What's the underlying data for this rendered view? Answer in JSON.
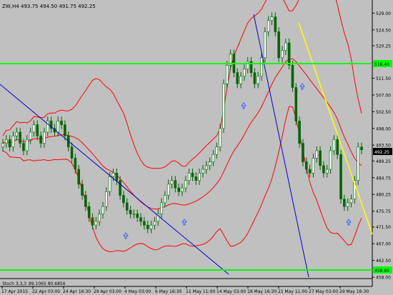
{
  "header": {
    "symbol": "ZW,H4",
    "ohlc": "493.75 494.50 491.75 492.25"
  },
  "sub_indicator": {
    "label": "Stoch 3,3,3",
    "values": "89.1065 80.6856"
  },
  "price_axis": {
    "ticks": [
      "529.00",
      "524.50",
      "520.25",
      "515.75",
      "511.50",
      "507.00",
      "502.50",
      "498.00",
      "493.50",
      "489.25",
      "484.75",
      "480.25",
      "475.75",
      "471.50",
      "467.00",
      "462.50",
      "458.00"
    ],
    "current_price": "492.25",
    "upper_line_label": "516.40",
    "lower_line_label": "458.85"
  },
  "time_axis": {
    "ticks": [
      "17 Apr 2015",
      "22 Apr 03:00",
      "24 Apr 16:30",
      "29 Apr 03:00",
      "4 May 03:00",
      "6 May 16:30",
      "11 May 11:00",
      "14 May 03:00",
      "18 May 16:30",
      "21 May 11:00",
      "27 May 03:00",
      "29 May 16:30"
    ]
  },
  "colors": {
    "background": "#c0c0c0",
    "candle": "#006400",
    "bollinger": "#ff0000",
    "hline": "#00ff00",
    "trendline": "#0000cc",
    "trendline_yellow": "#ffff00",
    "arrow": "#3366ff"
  },
  "chart_data": {
    "type": "line",
    "series": [
      {
        "values": [
          494,
          495,
          493,
          496,
          497,
          494,
          492,
          495,
          497,
          499,
          496,
          494,
          497,
          500,
          498,
          497,
          500,
          499,
          496,
          493,
          490,
          487,
          483,
          480,
          477,
          474,
          472,
          473,
          475,
          477,
          481,
          485,
          486,
          484,
          480,
          478,
          476,
          475,
          475,
          474,
          473,
          472,
          471,
          472,
          473,
          475,
          478,
          480,
          483,
          484,
          482,
          481,
          482,
          484,
          486,
          485,
          484,
          486,
          487,
          488,
          489,
          491,
          493,
          498,
          510,
          515,
          518,
          513,
          510,
          512,
          514,
          516,
          513,
          510,
          512,
          517,
          524,
          527,
          528,
          524,
          517,
          519,
          521,
          515,
          509,
          500,
          494,
          489,
          487,
          486,
          490,
          492,
          488,
          486,
          487,
          492,
          495,
          491,
          479,
          477,
          478,
          479,
          484,
          493,
          492.25
        ]
      }
    ],
    "ylim": [
      458,
      531
    ],
    "hlines": [
      516.4,
      458.85
    ]
  }
}
